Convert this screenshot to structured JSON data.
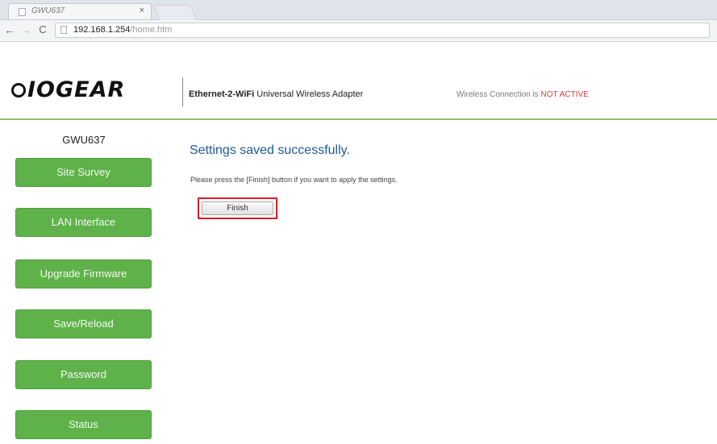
{
  "browser": {
    "tab_title": "GWU637",
    "tab_close": "×",
    "back": "←",
    "forward": "→",
    "reload": "C",
    "url_host": "192.168.1.254",
    "url_path": "/home.htm"
  },
  "header": {
    "logo": "IOGEAR",
    "product_bold": "Ethernet-2-WiFi",
    "product_rest": " Universal Wireless Adapter",
    "status_prefix": "Wireless Connection is ",
    "status_value": "NOT ACTIVE",
    "status_color": "#e23a3a",
    "accent": "#8cbf6c"
  },
  "sidebar": {
    "model": "GWU637",
    "items": [
      {
        "label": "Site Survey"
      },
      {
        "label": "LAN Interface"
      },
      {
        "label": "Upgrade Firmware"
      },
      {
        "label": "Save/Reload"
      },
      {
        "label": "Password"
      },
      {
        "label": "Status"
      }
    ],
    "button_color": "#5fb24a"
  },
  "main": {
    "message": "Settings saved successfully.",
    "instruction": "Please press the [Finish] button if you want to apply the settings.",
    "finish_label": "Finish",
    "highlight_color": "#e01b24"
  }
}
